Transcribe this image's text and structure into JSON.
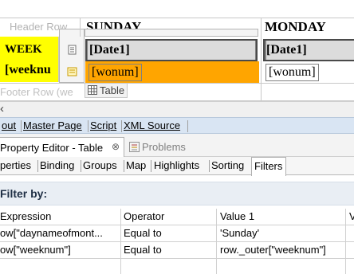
{
  "layout": {
    "header_row_label": "Header Row",
    "footer_row_label": "Footer Row (we",
    "columns": [
      "SUNDAY",
      "MONDAY"
    ],
    "week_label": "WEEK",
    "weeknum_expr": "[weeknu",
    "date_field": "[Date1]",
    "date_field_monday": "[Date1]",
    "wonum_field": "[wonum]",
    "wonum_field_monday": "[wonum]",
    "table_tag": "Table",
    "colors": {
      "yellow": "#ffff00",
      "orange": "#ffa500",
      "grey_cell": "#808080"
    }
  },
  "editor_tabs": [
    {
      "label": "out",
      "active": false
    },
    {
      "label": "Master Page",
      "active": false
    },
    {
      "label": "Script",
      "active": false
    },
    {
      "label": "XML Source",
      "active": false
    }
  ],
  "views": {
    "property_editor": "Property Editor - Table",
    "close_glyph": "⊗",
    "problems": "Problems"
  },
  "category_tabs": [
    "perties",
    "Binding",
    "Groups",
    "Map",
    "Highlights",
    "Sorting",
    "Filters"
  ],
  "active_category": "Filters",
  "filter": {
    "heading": "Filter by:",
    "columns": [
      "Expression",
      "Operator",
      "Value 1",
      "V"
    ],
    "rows": [
      {
        "expression": "ow[\"daynameofmont...",
        "operator": "Equal to",
        "value1": "'Sunday'"
      },
      {
        "expression": "ow[\"weeknum\"]",
        "operator": "Equal to",
        "value1": "row._outer[\"weeknum\"]"
      }
    ]
  }
}
